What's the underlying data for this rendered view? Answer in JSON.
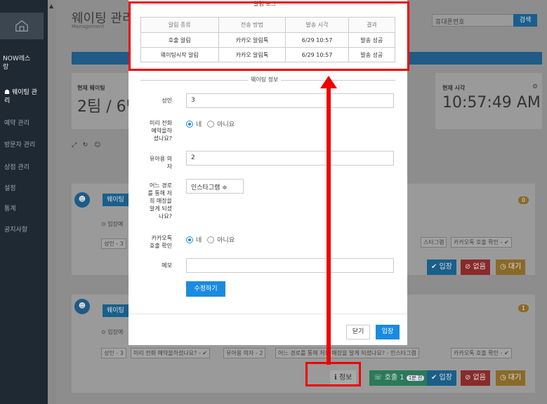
{
  "sidebar": {
    "brand": "NOW레스\n랑",
    "items": [
      {
        "label": "웨이팅 관\n리",
        "active": true
      },
      {
        "label": "예약 관리"
      },
      {
        "label": "방문자 관리"
      },
      {
        "label": "상점 관리"
      },
      {
        "label": "설정"
      },
      {
        "label": "통계"
      },
      {
        "label": "공지사항"
      }
    ]
  },
  "header": {
    "title": "웨이팅 관리",
    "subtitle": "Management",
    "search_placeholder": "휴대폰번호",
    "search_button": "검색"
  },
  "stats": {
    "current_waiting_label": "현재 웨이팅",
    "current_waiting_value": "2팀 / 6명",
    "current_time_label": "현재 시각",
    "current_time_value": "10:57:49 AM"
  },
  "cards": [
    {
      "button": "웨이팅",
      "entry_text": "⊙ 입장예",
      "pill_prefix": "성인 - 3",
      "pills_right": [
        "스타그램",
        "카카오톡 호출 확인 - ✔"
      ],
      "badge": "0",
      "actions": {
        "enter": "✔ 입장",
        "none": "⊘ 없음",
        "wait": "◷ 대기"
      }
    },
    {
      "button": "웨이팅",
      "entry_text": "⊙ 입장예",
      "pills": [
        "성인 - 3",
        "미리 전화 예약을하셨나요? - ✔",
        "유아용 의자 - 2",
        "어느 경로를 통해 저희 매장을 알게 되셨나요? - 인스타그램",
        "카카오톡 호출 확인 - ✔"
      ],
      "badge": "1",
      "actions": {
        "info": "ℹ 정보",
        "call": "☏ 호출 1",
        "call_badge": "1분 전",
        "enter": "✔ 입장",
        "none": "⊘ 없음",
        "wait": "◷ 대기"
      }
    }
  ],
  "modal": {
    "log_title": "알림 로그",
    "log_headers": [
      "알림 종류",
      "전송 방법",
      "발송 시각",
      "결과"
    ],
    "log_rows": [
      [
        "호출 알림",
        "카카오 알림톡",
        "6/29 10:57",
        "발송 성공"
      ],
      [
        "웨이팅시작 알림",
        "카카오 알림톡",
        "6/29 10:57",
        "발송 성공"
      ]
    ],
    "info_title": "웨이팅 정보",
    "fields": {
      "adult_label": "성인",
      "adult_value": "3",
      "reserve_label": "미리 전화\n예약을하\n셨나요?",
      "yes": "네",
      "no": "아니요",
      "child_seat_label": "유아용 의\n자",
      "child_seat_value": "2",
      "route_label": "어느 경로\n를 통해 저\n희 매장을\n알게 되셨\n나요?",
      "route_value": "인스타그램  ≑",
      "kakao_label": "카카오톡\n호출 확인",
      "memo_label": "메모",
      "memo_value": ""
    },
    "edit_button": "수정하기",
    "close_button": "닫기",
    "enter_button": "입장"
  },
  "colors": {
    "accent": "#1a8be0",
    "annotation": "#ee0000"
  }
}
